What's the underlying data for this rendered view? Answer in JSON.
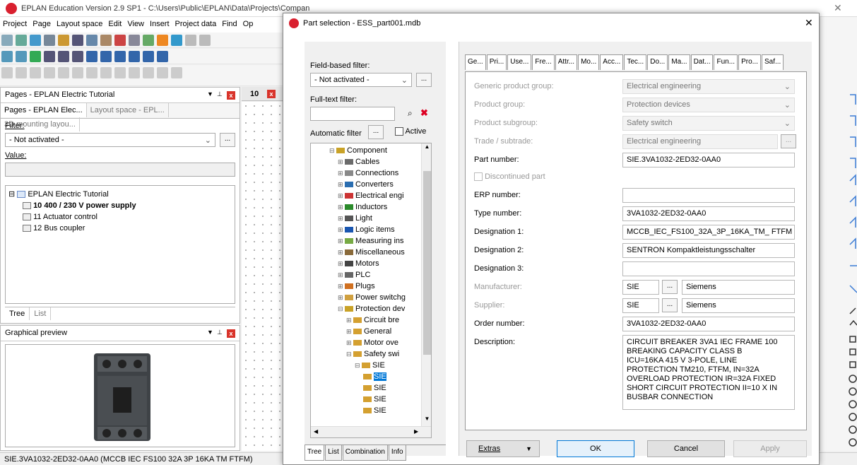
{
  "app": {
    "title": "EPLAN Education Version 2.9 SP1 - C:\\Users\\Public\\EPLAN\\Data\\Projects\\Compan",
    "menu": [
      "Project",
      "Page",
      "Layout space",
      "Edit",
      "View",
      "Insert",
      "Project data",
      "Find",
      "Op"
    ],
    "status": "SIE.3VA1032-2ED32-0AA0 (MCCB IEC FS100 32A 3P 16KA TM FTFM)"
  },
  "pages_pane": {
    "header": "Pages - EPLAN Electric Tutorial",
    "tabs": [
      "Pages - EPLAN Elec...",
      "Layout space - EPL...",
      "3D mounting layou..."
    ],
    "filter_label": "Filter:",
    "filter_value": "- Not activated -",
    "value_label": "Value:",
    "tree": [
      {
        "label": "EPLAN Electric Tutorial",
        "indent": 0
      },
      {
        "label": "10 400 / 230 V power supply",
        "indent": 1,
        "bold": true
      },
      {
        "label": "11 Actuator control",
        "indent": 1
      },
      {
        "label": "12 Bus coupler",
        "indent": 1
      }
    ],
    "bottom_tabs": [
      "Tree",
      "List"
    ]
  },
  "preview_pane": {
    "header": "Graphical preview"
  },
  "editor_tab": {
    "label": "10"
  },
  "dialog": {
    "title": "Part selection - ESS_part001.mdb",
    "field_filter_label": "Field-based filter:",
    "field_filter_value": "- Not activated -",
    "fulltext_label": "Full-text filter:",
    "auto_filter_label": "Automatic filter",
    "active_label": "Active",
    "tree": [
      {
        "label": "Component",
        "indent": 0,
        "open": true
      },
      {
        "label": "Cables",
        "indent": 1
      },
      {
        "label": "Connections",
        "indent": 1
      },
      {
        "label": "Converters",
        "indent": 1
      },
      {
        "label": "Electrical engi",
        "indent": 1
      },
      {
        "label": "Inductors",
        "indent": 1
      },
      {
        "label": "Light",
        "indent": 1
      },
      {
        "label": "Logic items",
        "indent": 1
      },
      {
        "label": "Measuring ins",
        "indent": 1
      },
      {
        "label": "Miscellaneous",
        "indent": 1
      },
      {
        "label": "Motors",
        "indent": 1
      },
      {
        "label": "PLC",
        "indent": 1
      },
      {
        "label": "Plugs",
        "indent": 1
      },
      {
        "label": "Power switchg",
        "indent": 1
      },
      {
        "label": "Protection dev",
        "indent": 1,
        "open": true
      },
      {
        "label": "Circuit bre",
        "indent": 2
      },
      {
        "label": "General",
        "indent": 2
      },
      {
        "label": "Motor ove",
        "indent": 2
      },
      {
        "label": "Safety swi",
        "indent": 2,
        "open": true
      },
      {
        "label": "SIE",
        "indent": 3,
        "open": true
      },
      {
        "label": "SIE",
        "indent": 4,
        "selected": true
      },
      {
        "label": "SIE",
        "indent": 4
      },
      {
        "label": "SIE",
        "indent": 4
      },
      {
        "label": "SIE",
        "indent": 4
      }
    ],
    "left_tabs": [
      "Tree",
      "List",
      "Combination",
      "Info"
    ],
    "tabs": [
      "Ge...",
      "Pri...",
      "Use...",
      "Fre...",
      "Attr...",
      "Mo...",
      "Acc...",
      "Tec...",
      "Do...",
      "Ma...",
      "Dat...",
      "Fun...",
      "Pro...",
      "Saf..."
    ],
    "fields": {
      "generic_group": {
        "label": "Generic product group:",
        "value": "Electrical engineering"
      },
      "product_group": {
        "label": "Product group:",
        "value": "Protection devices"
      },
      "product_subgroup": {
        "label": "Product subgroup:",
        "value": "Safety switch"
      },
      "trade": {
        "label": "Trade / subtrade:",
        "value": "Electrical engineering"
      },
      "part_number": {
        "label": "Part number:",
        "value": "SIE.3VA1032-2ED32-0AA0"
      },
      "discontinued": {
        "label": "Discontinued part"
      },
      "erp_number": {
        "label": "ERP number:",
        "value": ""
      },
      "type_number": {
        "label": "Type number:",
        "value": "3VA1032-2ED32-0AA0"
      },
      "designation1": {
        "label": "Designation 1:",
        "value": "MCCB_IEC_FS100_32A_3P_16KA_TM_ FTFM"
      },
      "designation2": {
        "label": "Designation 2:",
        "value": "SENTRON Kompaktleistungsschalter"
      },
      "designation3": {
        "label": "Designation 3:",
        "value": ""
      },
      "manufacturer": {
        "label": "Manufacturer:",
        "code": "SIE",
        "name": "Siemens"
      },
      "supplier": {
        "label": "Supplier:",
        "code": "SIE",
        "name": "Siemens"
      },
      "order_number": {
        "label": "Order number:",
        "value": "3VA1032-2ED32-0AA0"
      },
      "description": {
        "label": "Description:",
        "value": "CIRCUIT BREAKER 3VA1 IEC FRAME 100 BREAKING CAPACITY CLASS  B ICU=16KA  415 V 3-POLE, LINE PROTECTION TM210,  FTFM, IN=32A OVERLOAD PROTECTION IR=32A FIXED SHORT CIRCUIT PROTECTION II=10 X IN BUSBAR CONNECTION"
      }
    },
    "buttons": {
      "extras": "Extras",
      "ok": "OK",
      "cancel": "Cancel",
      "apply": "Apply"
    },
    "ellipsis": "..."
  }
}
